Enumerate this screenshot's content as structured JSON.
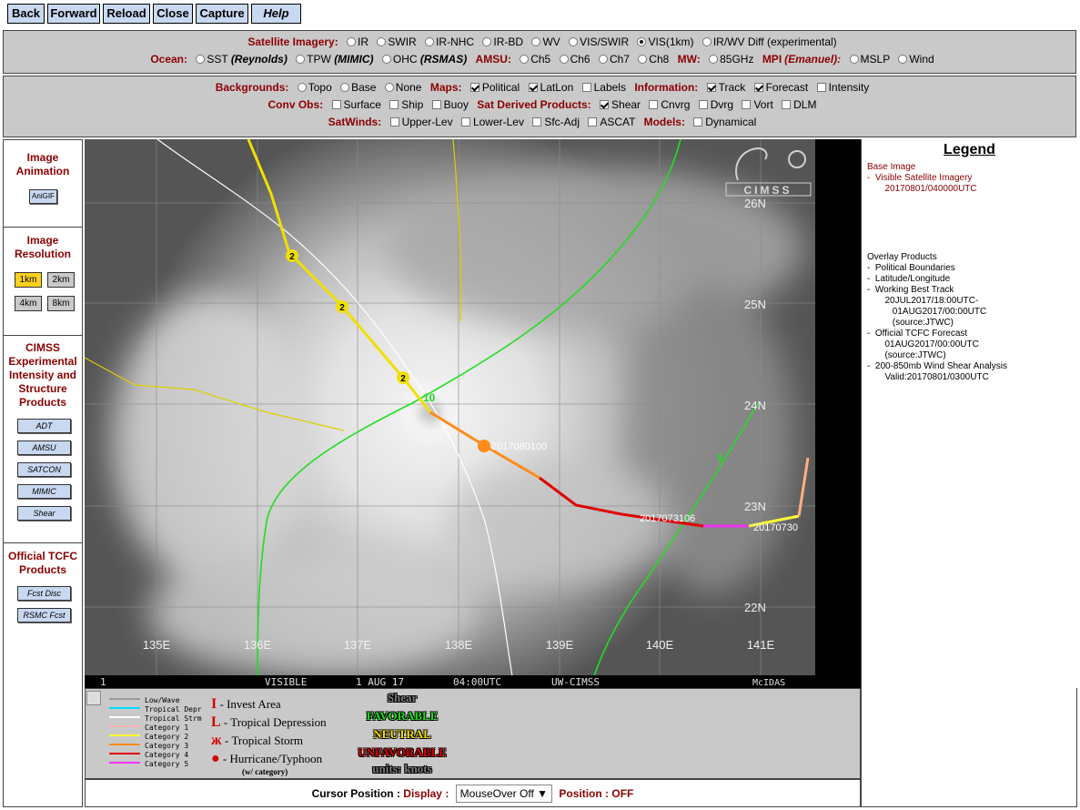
{
  "toolbar": {
    "buttons": [
      "Back",
      "Forward",
      "Reload",
      "Close",
      "Capture",
      "Help"
    ]
  },
  "panel1": {
    "sat_label": "Satellite Imagery:",
    "sat_options": [
      "IR",
      "SWIR",
      "IR-NHC",
      "IR-BD",
      "WV",
      "VIS/SWIR",
      "VIS(1km)",
      "IR/WV Diff (experimental)"
    ],
    "ocean_label": "Ocean:",
    "ocean_options": [
      "SST",
      "TPW",
      "OHC"
    ],
    "ocean_sources": [
      "(Reynolds)",
      "(MIMIC)",
      "(RSMAS)"
    ],
    "amsu_label": "AMSU:",
    "amsu_options": [
      "Ch5",
      "Ch6",
      "Ch7",
      "Ch8"
    ],
    "mw_label": "MW:",
    "mw_options": [
      "85GHz"
    ],
    "mpi_label": "MPI",
    "mpi_source": "(Emanuel):",
    "mpi_options": [
      "MSLP",
      "Wind"
    ]
  },
  "panel2": {
    "bg_label": "Backgrounds:",
    "bg_options": [
      "Topo",
      "Base",
      "None"
    ],
    "maps_label": "Maps:",
    "maps_options": [
      "Political",
      "LatLon",
      "Labels"
    ],
    "info_label": "Information:",
    "info_options": [
      "Track",
      "Forecast",
      "Intensity"
    ],
    "conv_label": "Conv Obs:",
    "conv_options": [
      "Surface",
      "Ship",
      "Buoy"
    ],
    "sdp_label": "Sat Derived Products:",
    "sdp_options": [
      "Shear",
      "Cnvrg",
      "Dvrg",
      "Vort",
      "DLM"
    ],
    "satwinds_label": "SatWinds:",
    "satwinds_options": [
      "Upper-Lev",
      "Lower-Lev",
      "Sfc-Adj",
      "ASCAT"
    ],
    "models_label": "Models:",
    "models_options": [
      "Dynamical"
    ]
  },
  "sidebar": {
    "anim_title": "Image Animation",
    "anim_button": "AniGIF",
    "res_title": "Image Resolution",
    "res_options": [
      "1km",
      "2km",
      "4km",
      "8km"
    ],
    "cimss_title": "CIMSS Experimental Intensity and Structure Products",
    "cimss_buttons": [
      "ADT",
      "AMSU",
      "SATCON",
      "MIMIC",
      "Shear"
    ],
    "tcfc_title": "Official TCFC Products",
    "tcfc_buttons": [
      "Fcst Disc",
      "RSMC Fcst"
    ]
  },
  "map": {
    "logo_text": "CIMSS",
    "lat_labels": [
      "26N",
      "25N",
      "24N",
      "23N",
      "22N"
    ],
    "lon_labels": [
      "135E",
      "136E",
      "137E",
      "138E",
      "139E",
      "140E",
      "141E"
    ],
    "track_intensity_labels": [
      "2",
      "2",
      "2"
    ],
    "current_marker_label": "2017080100",
    "track_time_label_1": "2017073106",
    "track_time_label_2": "20170730",
    "shear_labels": [
      "10",
      "5"
    ],
    "footer": {
      "frame": "1",
      "band": "VISIBLE",
      "date": "1 AUG 17",
      "time": "04:00UTC",
      "source": "UW-CIMSS",
      "software": "McIDAS"
    }
  },
  "legend": {
    "title": "Legend",
    "base_head": "Base Image",
    "base_item": "-  Visible Satellite Imagery",
    "base_time": "       20170801/040000UTC",
    "overlay_head": "Overlay Products",
    "overlay_lines": [
      "-  Political Boundaries",
      "-  Latitude/Longitude",
      "-  Working Best Track",
      "       20JUL2017/18:00UTC-",
      "          01AUG2017/00:00UTC",
      "          (source:JTWC)",
      "-  Official TCFC Forecast",
      "       01AUG2017/00:00UTC",
      "       (source:JTWC)",
      "-  200-850mb Wind Shear Analysis",
      "       Valid:20170801/0300UTC"
    ]
  },
  "track_legend": {
    "categories": [
      "Low/Wave",
      "Tropical Depr",
      "Tropical Strm",
      "Category 1",
      "Category 2",
      "Category 3",
      "Category 4",
      "Category 5"
    ],
    "category_colors": [
      "#9a9a9a",
      "#00e0ff",
      "#ffffff",
      "#ffb0b0",
      "#ffff33",
      "#ff8c1a",
      "#e00000",
      "#ff33ff"
    ],
    "symbols": [
      "- Invest Area",
      "- Tropical Depression",
      "- Tropical Storm",
      "- Hurricane/Typhoon"
    ],
    "symbols_note": "(w/ category)",
    "shear_title": "Shear",
    "shear_levels": [
      "FAVORABLE",
      "NEUTRAL",
      "UNFAVORABLE"
    ],
    "shear_units": "units: knots"
  },
  "cursor": {
    "label": "Cursor Position :",
    "display_label": "Display :",
    "select_value": "MouseOver Off",
    "position_label": "Position :",
    "position_value": "OFF"
  }
}
